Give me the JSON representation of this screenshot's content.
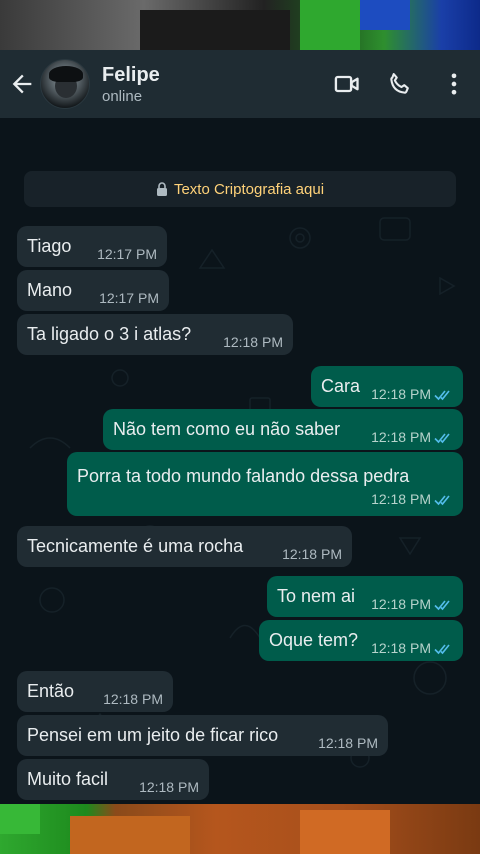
{
  "header": {
    "name": "Felipe",
    "status": "online"
  },
  "encryption_notice": "Texto Criptografia aqui",
  "colors": {
    "header_bg": "#1f2c33",
    "chat_bg": "#0b141a",
    "incoming_bubble": "#202c33",
    "outgoing_bubble": "#005c4b",
    "read_ticks": "#53bdeb",
    "notice_text": "#ffd279"
  },
  "icons": [
    "back-arrow-icon",
    "video-call-icon",
    "phone-call-icon",
    "more-options-icon",
    "lock-icon",
    "double-check-icon"
  ],
  "messages": [
    {
      "direction": "in",
      "text": "Tiago",
      "time": "12:17 PM"
    },
    {
      "direction": "in",
      "text": "Mano",
      "time": "12:17 PM"
    },
    {
      "direction": "in",
      "text": "Ta ligado o 3 i atlas?",
      "time": "12:18 PM"
    },
    {
      "direction": "out",
      "text": "Cara",
      "time": "12:18 PM",
      "read": true
    },
    {
      "direction": "out",
      "text": "Não tem como eu não saber",
      "time": "12:18 PM",
      "read": true
    },
    {
      "direction": "out",
      "text": "Porra ta todo mundo falando dessa pedra",
      "time": "12:18 PM",
      "read": true
    },
    {
      "direction": "in",
      "text": "Tecnicamente é uma rocha",
      "time": "12:18 PM"
    },
    {
      "direction": "out",
      "text": "To nem ai",
      "time": "12:18 PM",
      "read": true
    },
    {
      "direction": "out",
      "text": "Oque tem?",
      "time": "12:18 PM",
      "read": true
    },
    {
      "direction": "in",
      "text": "Então",
      "time": "12:18 PM"
    },
    {
      "direction": "in",
      "text": "Pensei em um jeito de ficar rico",
      "time": "12:18 PM"
    },
    {
      "direction": "in",
      "text": "Muito facil",
      "time": "12:18 PM"
    }
  ]
}
